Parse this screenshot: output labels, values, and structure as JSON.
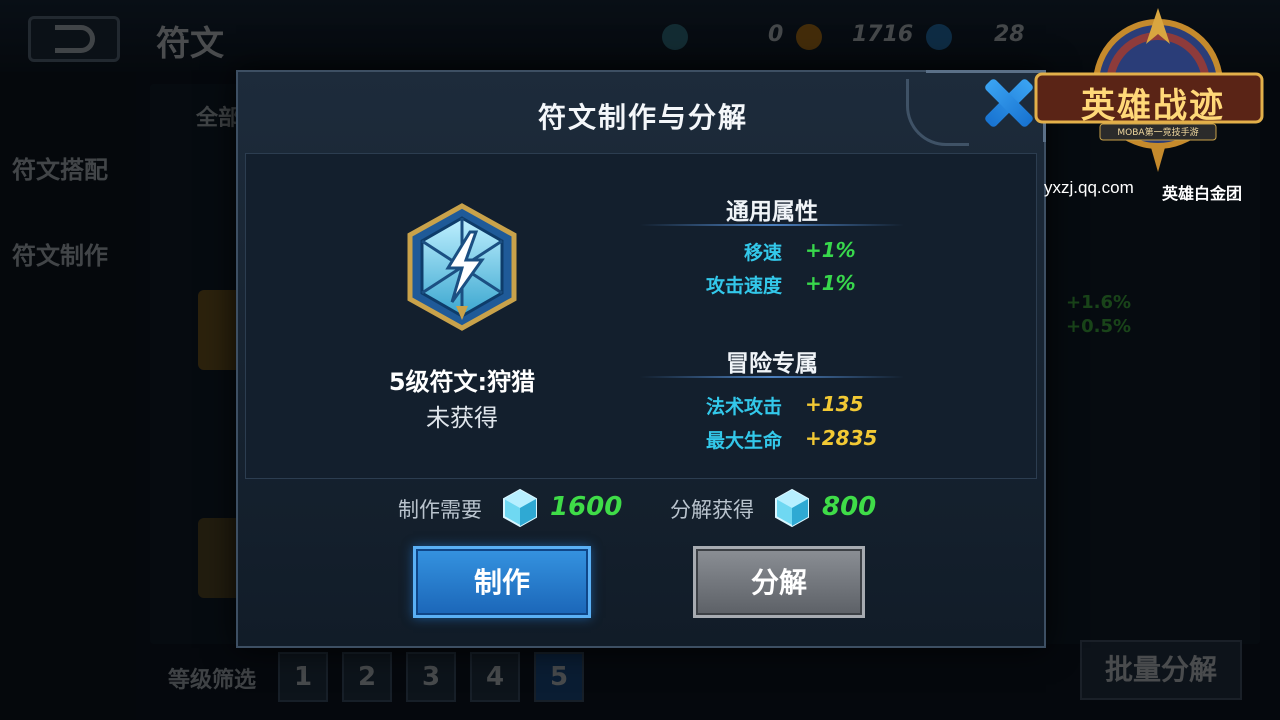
{
  "background": {
    "title": "符文",
    "currencies": [
      {
        "value": "0",
        "icon": "gold-coin-icon"
      },
      {
        "value": "1716",
        "icon": "diamond-icon"
      },
      {
        "value": "28",
        "icon": "crystal-icon"
      }
    ],
    "sidebar": [
      {
        "label": "符文搭配"
      },
      {
        "label": "符文制作"
      }
    ],
    "tab_label": "全部",
    "filter_label": "等级筛选",
    "levels": [
      "1",
      "2",
      "3",
      "4",
      "5"
    ],
    "batch_label": "批量分解",
    "partial_stats": [
      "+1.6%",
      "+0.5%"
    ]
  },
  "modal": {
    "title": "符文制作与分解",
    "rune": {
      "name": "5级符文:狩猎",
      "status": "未获得",
      "icon": "lightning-rune-icon"
    },
    "general": {
      "title": "通用属性",
      "attrs": [
        {
          "name": "移速",
          "value": "+1%"
        },
        {
          "name": "攻击速度",
          "value": "+1%"
        }
      ]
    },
    "adventure": {
      "title": "冒险专属",
      "attrs": [
        {
          "name": "法术攻击",
          "value": "+135"
        },
        {
          "name": "最大生命",
          "value": "+2835"
        }
      ]
    },
    "make_cost": {
      "label": "制作需要",
      "value": "1600"
    },
    "split_gain": {
      "label": "分解获得",
      "value": "800"
    },
    "make_button": "制作",
    "split_button": "分解"
  },
  "watermark": {
    "logo_text": "英雄战迹",
    "logo_sub": "MOBA第一竞技手游",
    "url": "yxzj.qq.com",
    "team": "英雄白金团"
  },
  "colors": {
    "accent_blue": "#1b66b8",
    "attr_name": "#33c8ea",
    "positive_green": "#38d84c",
    "adventure_yellow": "#f2c934"
  }
}
